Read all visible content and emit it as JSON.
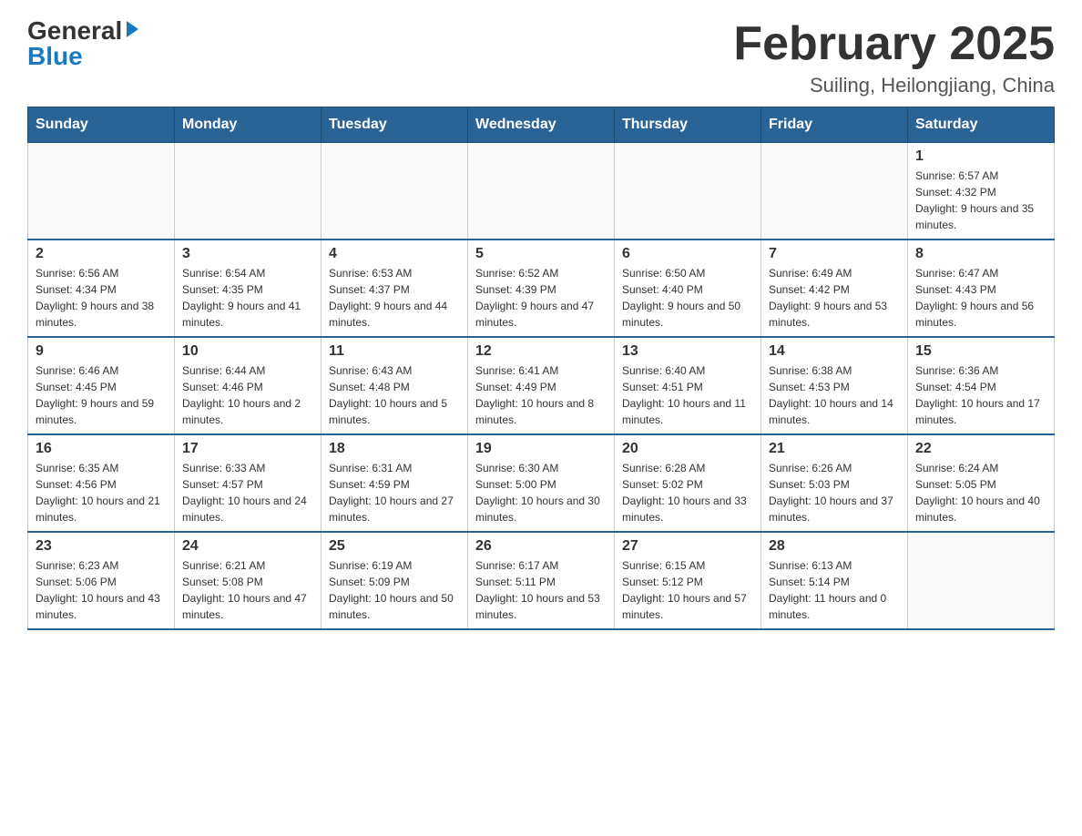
{
  "header": {
    "logo_general": "General",
    "logo_blue": "Blue",
    "month_title": "February 2025",
    "location": "Suiling, Heilongjiang, China"
  },
  "days_of_week": [
    "Sunday",
    "Monday",
    "Tuesday",
    "Wednesday",
    "Thursday",
    "Friday",
    "Saturday"
  ],
  "weeks": [
    [
      {
        "day": "",
        "info": ""
      },
      {
        "day": "",
        "info": ""
      },
      {
        "day": "",
        "info": ""
      },
      {
        "day": "",
        "info": ""
      },
      {
        "day": "",
        "info": ""
      },
      {
        "day": "",
        "info": ""
      },
      {
        "day": "1",
        "info": "Sunrise: 6:57 AM\nSunset: 4:32 PM\nDaylight: 9 hours and 35 minutes."
      }
    ],
    [
      {
        "day": "2",
        "info": "Sunrise: 6:56 AM\nSunset: 4:34 PM\nDaylight: 9 hours and 38 minutes."
      },
      {
        "day": "3",
        "info": "Sunrise: 6:54 AM\nSunset: 4:35 PM\nDaylight: 9 hours and 41 minutes."
      },
      {
        "day": "4",
        "info": "Sunrise: 6:53 AM\nSunset: 4:37 PM\nDaylight: 9 hours and 44 minutes."
      },
      {
        "day": "5",
        "info": "Sunrise: 6:52 AM\nSunset: 4:39 PM\nDaylight: 9 hours and 47 minutes."
      },
      {
        "day": "6",
        "info": "Sunrise: 6:50 AM\nSunset: 4:40 PM\nDaylight: 9 hours and 50 minutes."
      },
      {
        "day": "7",
        "info": "Sunrise: 6:49 AM\nSunset: 4:42 PM\nDaylight: 9 hours and 53 minutes."
      },
      {
        "day": "8",
        "info": "Sunrise: 6:47 AM\nSunset: 4:43 PM\nDaylight: 9 hours and 56 minutes."
      }
    ],
    [
      {
        "day": "9",
        "info": "Sunrise: 6:46 AM\nSunset: 4:45 PM\nDaylight: 9 hours and 59 minutes."
      },
      {
        "day": "10",
        "info": "Sunrise: 6:44 AM\nSunset: 4:46 PM\nDaylight: 10 hours and 2 minutes."
      },
      {
        "day": "11",
        "info": "Sunrise: 6:43 AM\nSunset: 4:48 PM\nDaylight: 10 hours and 5 minutes."
      },
      {
        "day": "12",
        "info": "Sunrise: 6:41 AM\nSunset: 4:49 PM\nDaylight: 10 hours and 8 minutes."
      },
      {
        "day": "13",
        "info": "Sunrise: 6:40 AM\nSunset: 4:51 PM\nDaylight: 10 hours and 11 minutes."
      },
      {
        "day": "14",
        "info": "Sunrise: 6:38 AM\nSunset: 4:53 PM\nDaylight: 10 hours and 14 minutes."
      },
      {
        "day": "15",
        "info": "Sunrise: 6:36 AM\nSunset: 4:54 PM\nDaylight: 10 hours and 17 minutes."
      }
    ],
    [
      {
        "day": "16",
        "info": "Sunrise: 6:35 AM\nSunset: 4:56 PM\nDaylight: 10 hours and 21 minutes."
      },
      {
        "day": "17",
        "info": "Sunrise: 6:33 AM\nSunset: 4:57 PM\nDaylight: 10 hours and 24 minutes."
      },
      {
        "day": "18",
        "info": "Sunrise: 6:31 AM\nSunset: 4:59 PM\nDaylight: 10 hours and 27 minutes."
      },
      {
        "day": "19",
        "info": "Sunrise: 6:30 AM\nSunset: 5:00 PM\nDaylight: 10 hours and 30 minutes."
      },
      {
        "day": "20",
        "info": "Sunrise: 6:28 AM\nSunset: 5:02 PM\nDaylight: 10 hours and 33 minutes."
      },
      {
        "day": "21",
        "info": "Sunrise: 6:26 AM\nSunset: 5:03 PM\nDaylight: 10 hours and 37 minutes."
      },
      {
        "day": "22",
        "info": "Sunrise: 6:24 AM\nSunset: 5:05 PM\nDaylight: 10 hours and 40 minutes."
      }
    ],
    [
      {
        "day": "23",
        "info": "Sunrise: 6:23 AM\nSunset: 5:06 PM\nDaylight: 10 hours and 43 minutes."
      },
      {
        "day": "24",
        "info": "Sunrise: 6:21 AM\nSunset: 5:08 PM\nDaylight: 10 hours and 47 minutes."
      },
      {
        "day": "25",
        "info": "Sunrise: 6:19 AM\nSunset: 5:09 PM\nDaylight: 10 hours and 50 minutes."
      },
      {
        "day": "26",
        "info": "Sunrise: 6:17 AM\nSunset: 5:11 PM\nDaylight: 10 hours and 53 minutes."
      },
      {
        "day": "27",
        "info": "Sunrise: 6:15 AM\nSunset: 5:12 PM\nDaylight: 10 hours and 57 minutes."
      },
      {
        "day": "28",
        "info": "Sunrise: 6:13 AM\nSunset: 5:14 PM\nDaylight: 11 hours and 0 minutes."
      },
      {
        "day": "",
        "info": ""
      }
    ]
  ]
}
